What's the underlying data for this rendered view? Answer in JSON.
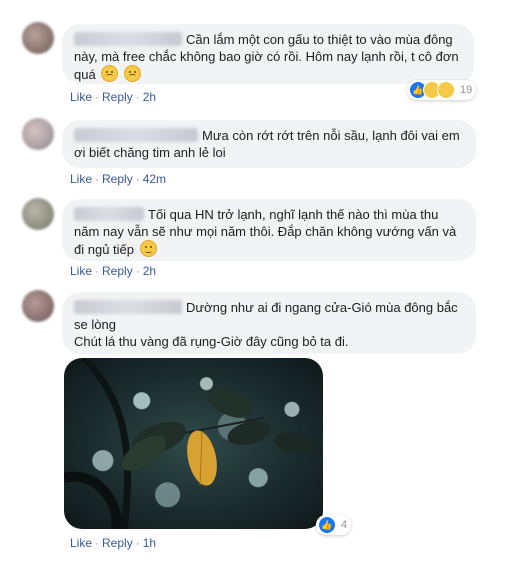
{
  "comments": [
    {
      "text": "Cần lắm một con gấu to thiệt to vào mùa đông này, mà free chắc không bao giờ có rồi. Hôm nay lạnh rồi, t cô đơn quá",
      "like": "Like",
      "reply": "Reply",
      "time": "2h",
      "reaction_count": "19",
      "reactions": [
        "like-icon",
        "haha-icon",
        "sad-icon"
      ]
    },
    {
      "text": "Mưa còn rớt rớt trên nỗi sầu, lạnh đôi vai em ơi biết chăng tim anh lẻ loi",
      "like": "Like",
      "reply": "Reply",
      "time": "42m"
    },
    {
      "text": "Tối qua HN trở lạnh, nghĩ lạnh thế nào thì mùa thu năm nay vẫn sẽ như mọi năm thôi. Đắp chăn không vướng vấn và đi ngủ tiếp",
      "like": "Like",
      "reply": "Reply",
      "time": "2h"
    },
    {
      "text_line1": "Dường như ai đi ngang cửa-Gió mùa đông bắc se lòng",
      "text_line2": "Chút lá thu vàng đã rụng-Giờ đây cũng bỏ ta đi.",
      "like": "Like",
      "reply": "Reply",
      "time": "1h",
      "reaction_count": "4",
      "reactions": [
        "like-icon"
      ]
    }
  ],
  "colors": {
    "bubble": "#f2f3f5",
    "link": "#385898",
    "like_blue": "#1877f2"
  }
}
